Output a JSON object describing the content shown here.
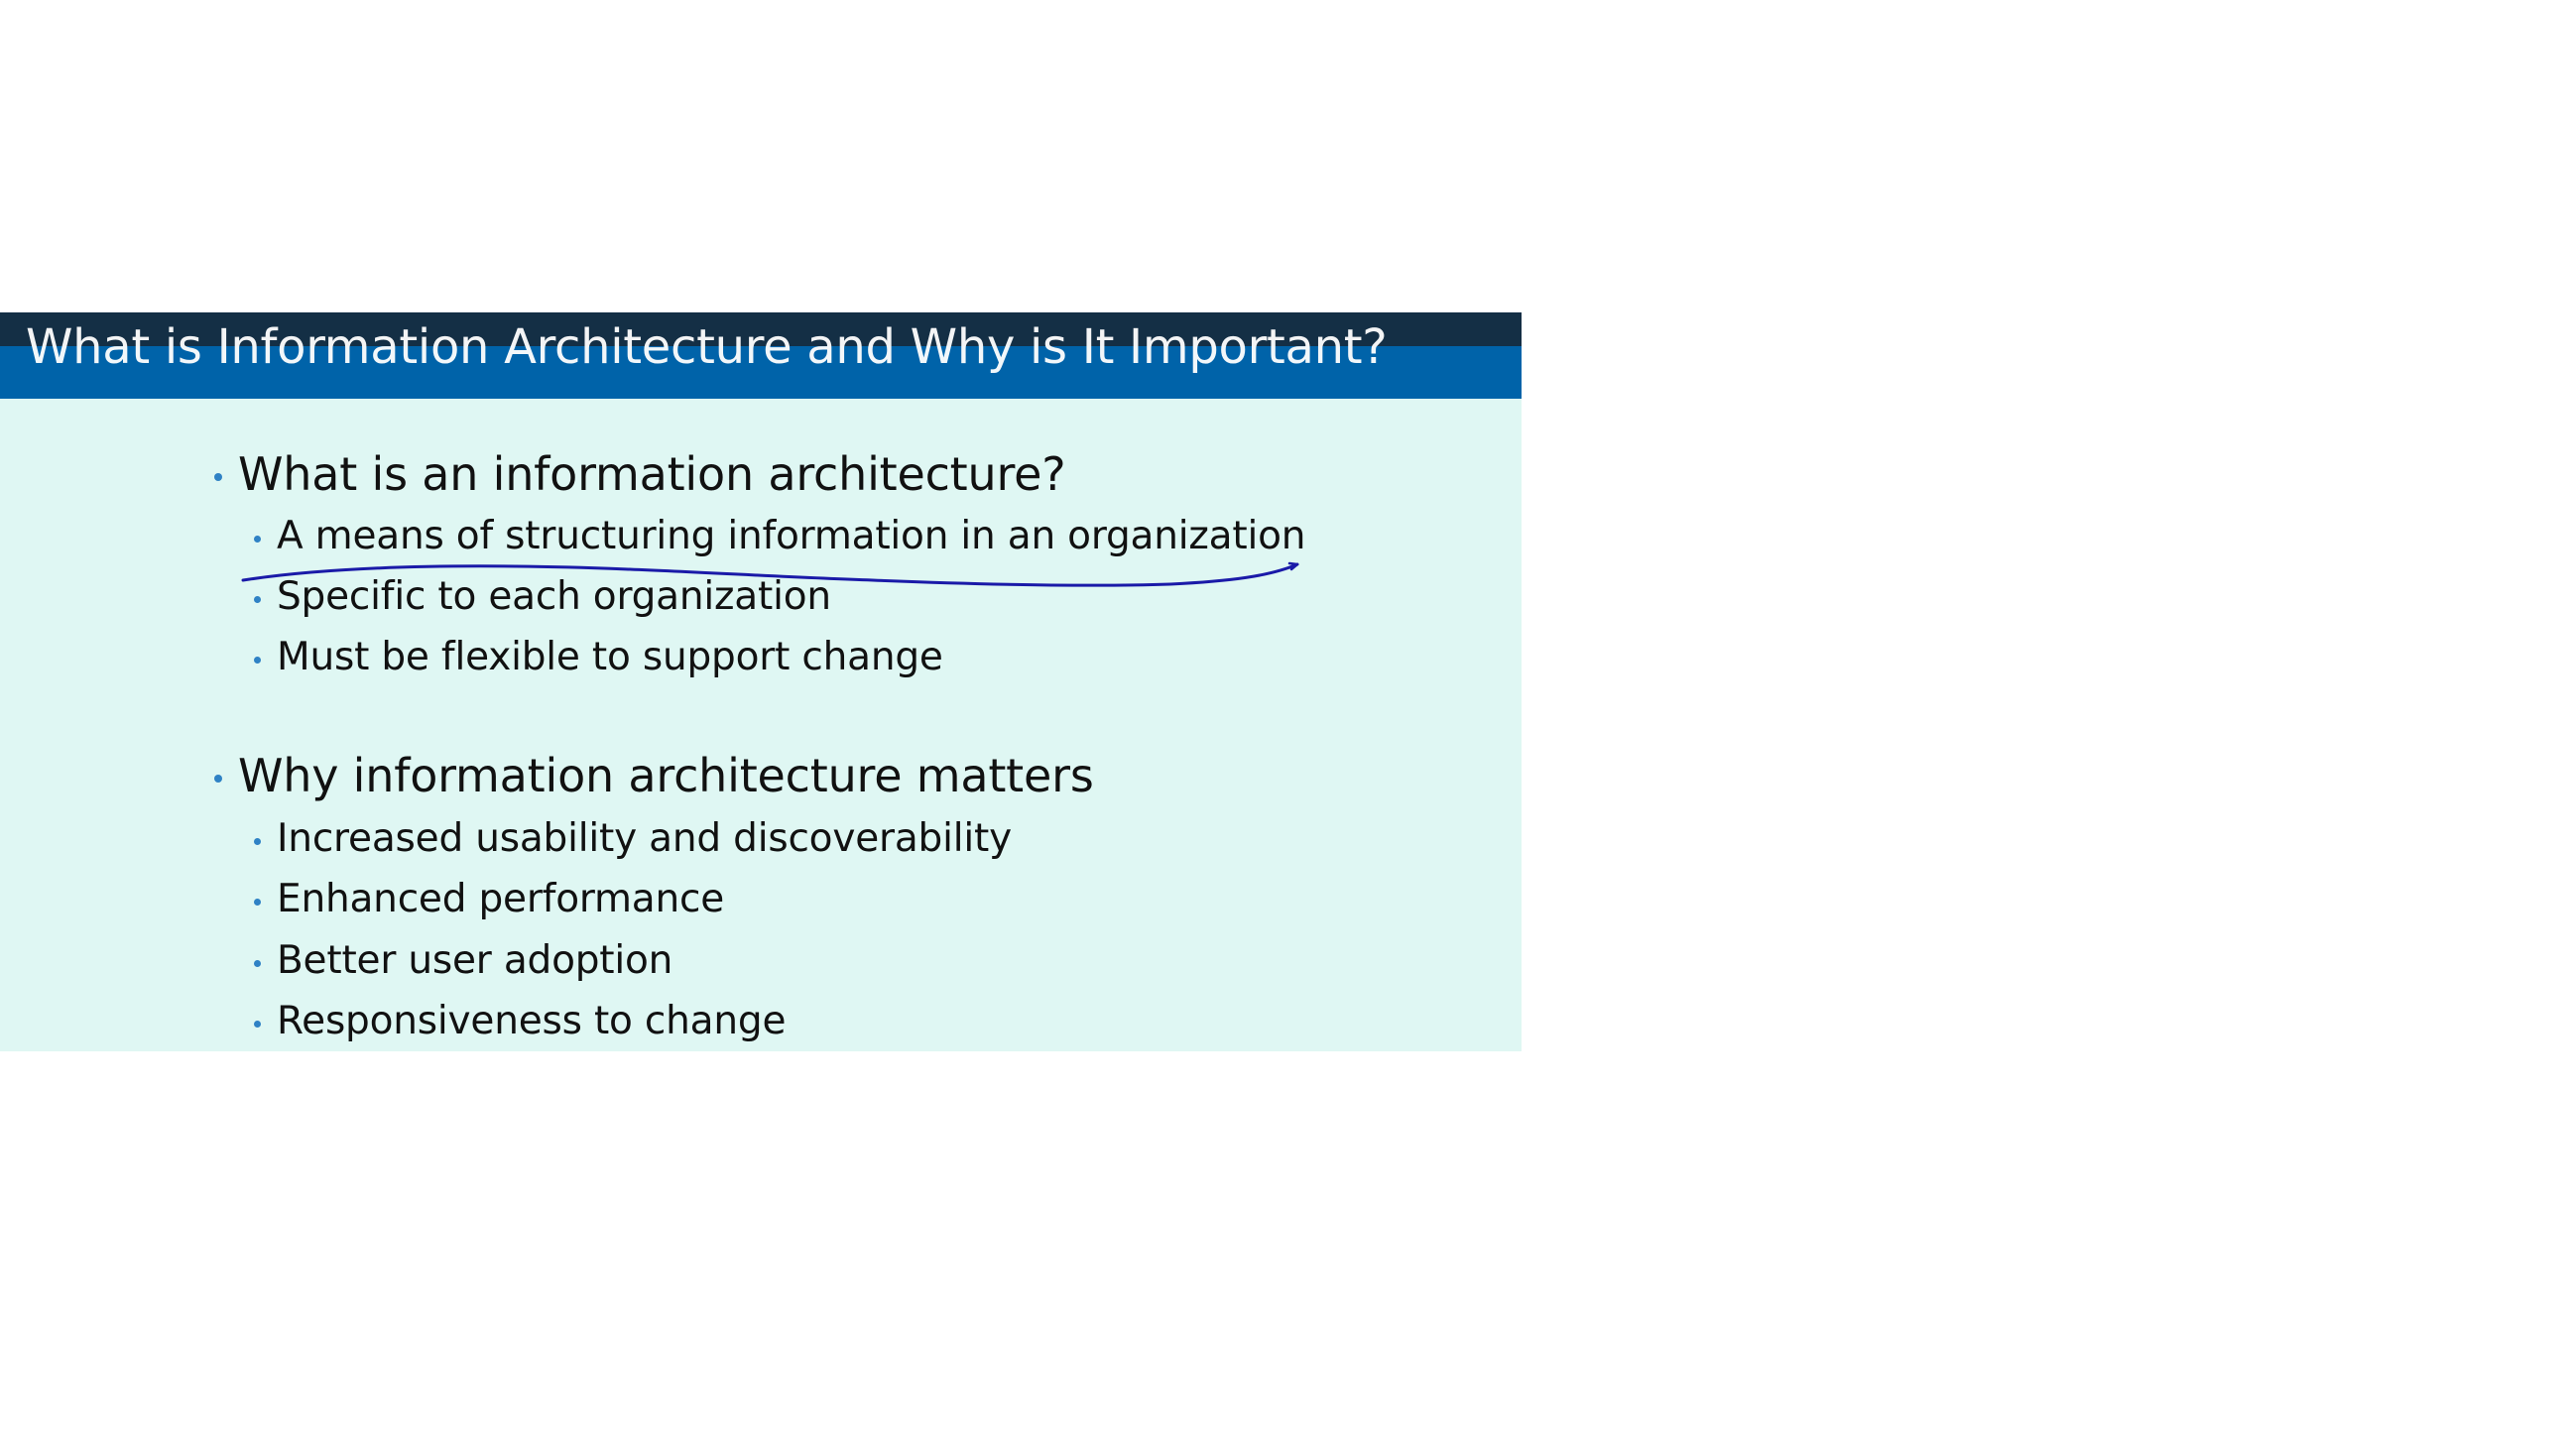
{
  "slide": {
    "title": "What is Information Architecture and Why is It Important?",
    "sections": [
      {
        "heading": "What is an information architecture?",
        "items": [
          "A means of structuring information in an organization",
          "Specific to each organization",
          "Must be flexible to support change"
        ]
      },
      {
        "heading": "Why information architecture matters",
        "items": [
          "Increased usability and discoverability",
          "Enhanced performance",
          "Better user adoption",
          "Responsiveness to change"
        ]
      }
    ],
    "colors": {
      "title_bar": "#0063a9",
      "title_strip": "#142f45",
      "background": "#dff7f3",
      "bullet": "#2f82c5",
      "annotation_ink": "#1a1aa8"
    }
  }
}
